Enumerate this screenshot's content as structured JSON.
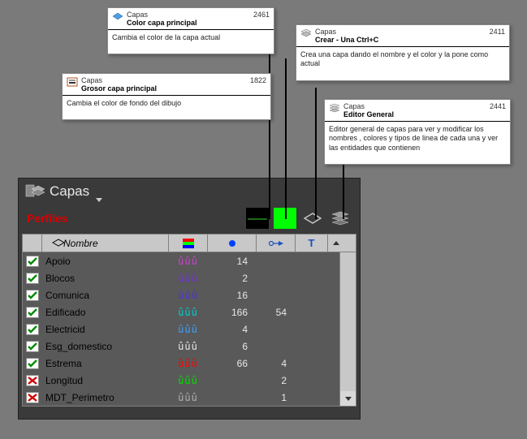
{
  "tooltips": {
    "color": {
      "category": "Capas",
      "title": "Color capa principal",
      "num": "2461",
      "body": "Cambia el color de la capa actual"
    },
    "grosor": {
      "category": "Capas",
      "title": "Grosor capa principal",
      "num": "1822",
      "body": "Cambia el color de fondo del dibujo"
    },
    "crear": {
      "category": "Capas",
      "title": "Crear - Una      Ctrl+C",
      "num": "2411",
      "body": "Crea una capa dando el nombre y el color y la pone como actual"
    },
    "editor": {
      "category": "Capas",
      "title": "Editor General",
      "num": "2441",
      "body": "Editor general de capas para ver y modificar los nombres , colores y tipos de linea de cada una y ver las entidades que contienen"
    }
  },
  "panel": {
    "title": "Capas",
    "section": "Perfiles",
    "headers": {
      "name": "Nombre",
      "c2_icon": "count-icon",
      "c3_label": "T"
    },
    "rows": [
      {
        "on": true,
        "name": "Apoio",
        "clr": "#d040d0",
        "swatch": "ûûû",
        "c1": "14",
        "c2": ""
      },
      {
        "on": true,
        "name": "Blocos",
        "clr": "#7030d8",
        "swatch": "ûûû",
        "c1": "2",
        "c2": ""
      },
      {
        "on": true,
        "name": "Comunica",
        "clr": "#5030d8",
        "swatch": "ûûû",
        "c1": "16",
        "c2": ""
      },
      {
        "on": true,
        "name": "Edificado",
        "clr": "#00d0d0",
        "swatch": "ûûû",
        "c1": "166",
        "c2": "54"
      },
      {
        "on": true,
        "name": "Electricid",
        "clr": "#40a0ff",
        "swatch": "ûûû",
        "c1": "4",
        "c2": ""
      },
      {
        "on": true,
        "name": "Esg_domestico",
        "clr": "#e8e8e8",
        "swatch": "ûûû",
        "c1": "6",
        "c2": ""
      },
      {
        "on": true,
        "name": "Estrema",
        "clr": "#ff0000",
        "swatch": "ûûû",
        "c1": "66",
        "c2": "4"
      },
      {
        "on": false,
        "name": "Longitud",
        "clr": "#00e000",
        "swatch": "ûûû",
        "c1": "",
        "c2": "2"
      },
      {
        "on": false,
        "name": "MDT_Perimetro",
        "clr": "#b0b0b0",
        "swatch": "ûûû",
        "c1": "",
        "c2": "1"
      }
    ]
  }
}
